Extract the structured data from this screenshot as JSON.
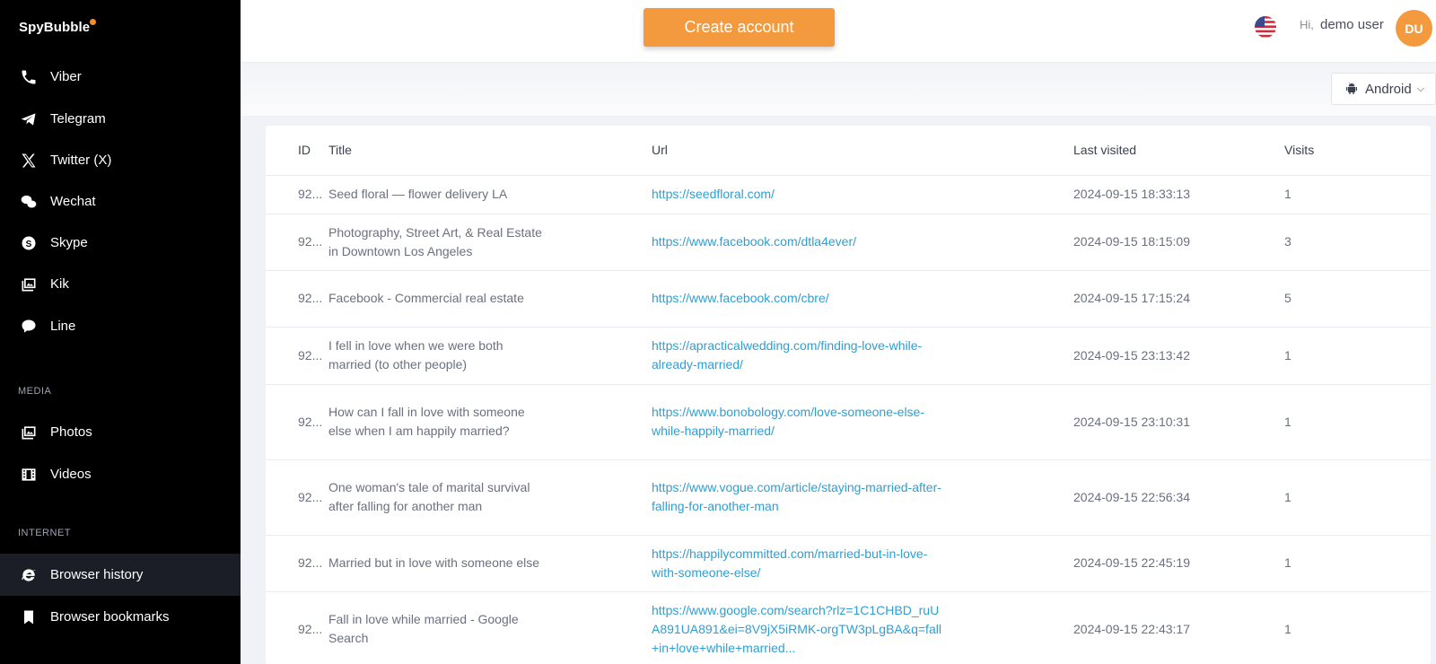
{
  "app": {
    "logo": "SpyBubble"
  },
  "sidebar": {
    "items_top": [
      {
        "label": "Viber",
        "icon": "phone-icon"
      },
      {
        "label": "Telegram",
        "icon": "telegram-icon"
      },
      {
        "label": "Twitter (X)",
        "icon": "x-icon"
      },
      {
        "label": "Wechat",
        "icon": "wechat-icon"
      },
      {
        "label": "Skype",
        "icon": "skype-icon"
      },
      {
        "label": "Kik",
        "icon": "image-gallery-icon"
      },
      {
        "label": "Line",
        "icon": "line-icon"
      }
    ],
    "media_label": "MEDIA",
    "media_items": [
      {
        "label": "Photos",
        "icon": "photos-icon"
      },
      {
        "label": "Videos",
        "icon": "film-icon"
      }
    ],
    "internet_label": "INTERNET",
    "internet_items": [
      {
        "label": "Browser history",
        "icon": "browser-e-icon",
        "active": true
      },
      {
        "label": "Browser bookmarks",
        "icon": "bookmark-icon"
      }
    ]
  },
  "header": {
    "create_button": "Create account",
    "greeting": "Hi,",
    "username": "demo user",
    "avatar_initials": "DU",
    "accent": "#f39a3e"
  },
  "device_select": {
    "value": "Android"
  },
  "table": {
    "headers": [
      "ID",
      "Title",
      "Url",
      "Last visited",
      "Visits"
    ],
    "rows": [
      {
        "id": "92...",
        "title": "Seed floral — flower delivery LA",
        "url": "https://seedfloral.com/",
        "last": "2024-09-15 18:33:13",
        "visits": "1"
      },
      {
        "id": "92...",
        "title": "Photography, Street Art, & Real Estate in Downtown Los Angeles",
        "url": "https://www.facebook.com/dtla4ever/",
        "last": "2024-09-15 18:15:09",
        "visits": "3"
      },
      {
        "id": "92...",
        "title": "Facebook - Commercial real estate",
        "url": "https://www.facebook.com/cbre/",
        "last": "2024-09-15 17:15:24",
        "visits": "5"
      },
      {
        "id": "92...",
        "title": "I fell in love when we were both married (to other people)",
        "url": "https://apracticalwedding.com/finding-love-while-already-married/",
        "last": "2024-09-15 23:13:42",
        "visits": "1"
      },
      {
        "id": "92...",
        "title": "How can I fall in love with someone else when I am happily married?",
        "url": "https://www.bonobology.com/love-someone-else-while-happily-married/",
        "last": "2024-09-15 23:10:31",
        "visits": "1"
      },
      {
        "id": "92...",
        "title": "One woman's tale of marital survival after falling for another man",
        "url": "https://www.vogue.com/article/staying-married-after-falling-for-another-man",
        "last": "2024-09-15 22:56:34",
        "visits": "1"
      },
      {
        "id": "92...",
        "title": "Married but in love with someone else",
        "url": "https://happilycommitted.com/married-but-in-love-with-someone-else/",
        "last": "2024-09-15 22:45:19",
        "visits": "1"
      },
      {
        "id": "92...",
        "title": "Fall in love while married - Google Search",
        "url": "https://www.google.com/search?rlz=1C1CHBD_ruUA891UA891&ei=8V9jX5iRMK-orgTW3pLgBA&q=fall+in+love+while+married...",
        "last": "2024-09-15 22:43:17",
        "visits": "1"
      }
    ]
  }
}
